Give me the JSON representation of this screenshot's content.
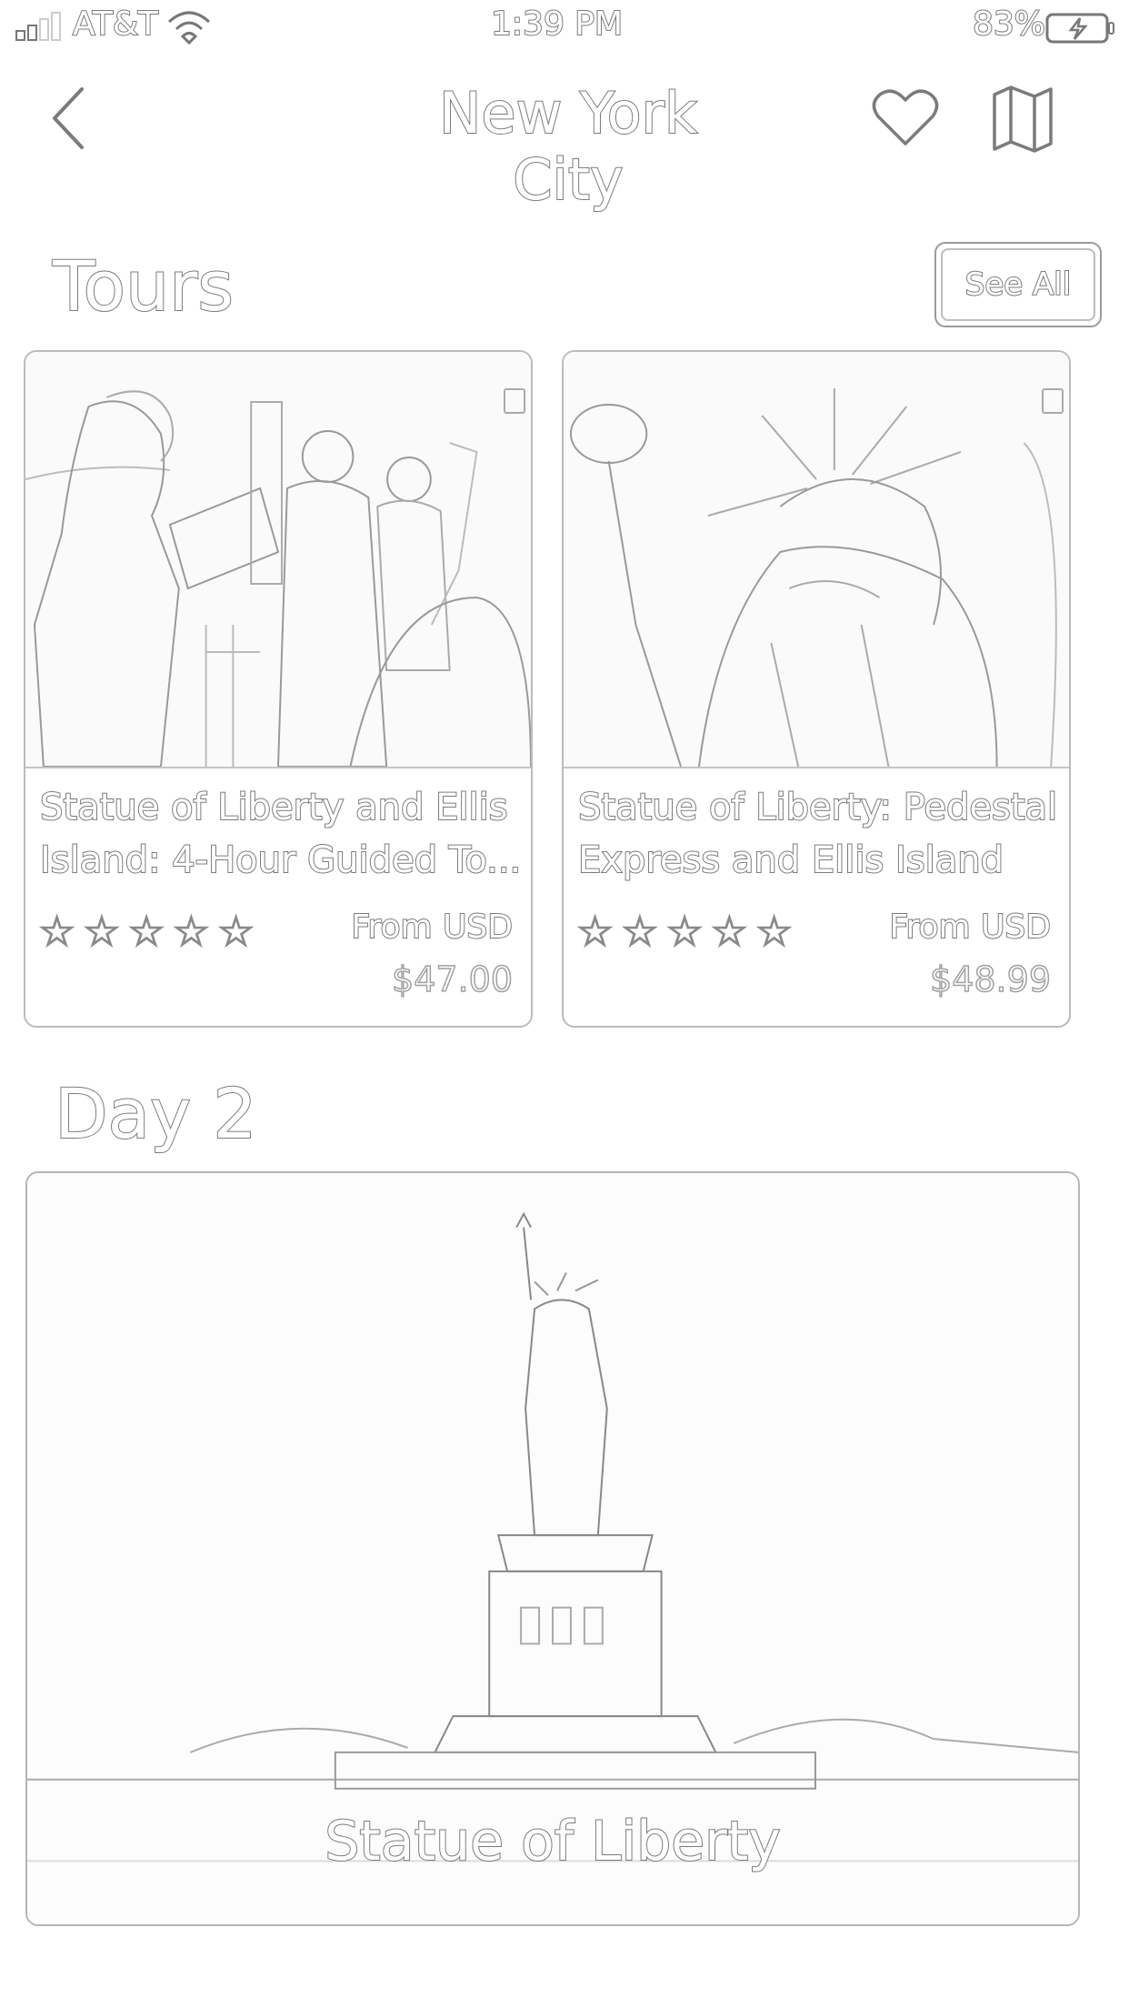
{
  "status_bar": {
    "carrier": "AT&T",
    "time": "1:39 PM",
    "battery_percent": "83%",
    "signal_icon": "cell-signal-icon",
    "wifi_icon": "wifi-icon",
    "battery_icon": "battery-charging-icon"
  },
  "nav": {
    "title": "New York City",
    "back_icon": "chevron-left-icon",
    "favorite_icon": "heart-icon",
    "map_icon": "map-icon"
  },
  "tours": {
    "title": "Tours",
    "see_all_label": "See All",
    "items": [
      {
        "name": "Statue of Liberty and Ellis Island: 4-Hour Guided To...",
        "stars": "☆☆☆☆☆",
        "rating": 0,
        "from_label": "From USD",
        "price": "$47.00",
        "image": "tour-guide-group-photo"
      },
      {
        "name": "Statue of Liberty: Pedestal Express and Ellis Island",
        "stars": "☆☆☆☆☆",
        "rating": 0,
        "from_label": "From USD",
        "price": "$48.99",
        "image": "statue-of-liberty-closeup-photo"
      }
    ]
  },
  "day": {
    "title": "Day 2",
    "attraction": {
      "name": "Statue of Liberty",
      "image": "statue-of-liberty-island-photo"
    }
  },
  "colors": {
    "outline": "#7b7b7b",
    "border": "#bcbcbc",
    "background": "#ffffff"
  }
}
